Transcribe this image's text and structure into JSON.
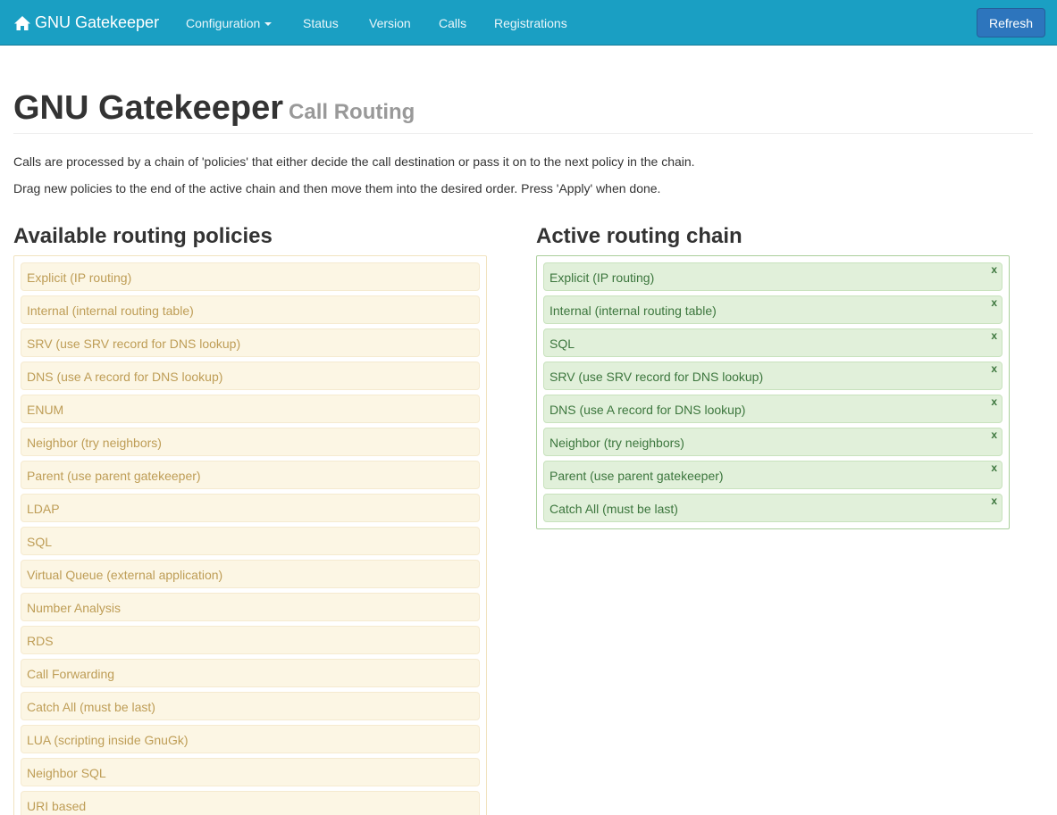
{
  "navbar": {
    "brand": "GNU Gatekeeper",
    "items": [
      "Configuration",
      "Status",
      "Version",
      "Calls",
      "Registrations"
    ],
    "refresh_label": "Refresh"
  },
  "header": {
    "title": "GNU Gatekeeper",
    "subtitle": "Call Routing"
  },
  "description": [
    "Calls are processed by a chain of 'policies' that either decide the call destination or pass it on to the next policy in the chain.",
    "Drag new policies to the end of the active chain and then move them into the desired order. Press 'Apply' when done."
  ],
  "available": {
    "title": "Available routing policies",
    "items": [
      "Explicit (IP routing)",
      "Internal (internal routing table)",
      "SRV (use SRV record for DNS lookup)",
      "DNS (use A record for DNS lookup)",
      "ENUM",
      "Neighbor (try neighbors)",
      "Parent (use parent gatekeeper)",
      "LDAP",
      "SQL",
      "Virtual Queue (external application)",
      "Number Analysis",
      "RDS",
      "Call Forwarding",
      "Catch All (must be last)",
      "LUA (scripting inside GnuGk)",
      "Neighbor SQL",
      "URI based"
    ]
  },
  "active": {
    "title": "Active routing chain",
    "remove_label": "x",
    "items": [
      "Explicit (IP routing)",
      "Internal (internal routing table)",
      "SQL",
      "SRV (use SRV record for DNS lookup)",
      "DNS (use A record for DNS lookup)",
      "Neighbor (try neighbors)",
      "Parent (use parent gatekeeper)",
      "Catch All (must be last)"
    ]
  },
  "colors": {
    "navbar": "#1a9fc3",
    "refresh_button": "#2d75bd",
    "available_item_bg": "#fcf6e4",
    "available_item_text": "#be9d56",
    "active_item_bg": "#e1f0da",
    "active_item_text": "#3c763d"
  },
  "icons": {
    "brand": "home-icon",
    "dropdown": "caret-down-icon"
  }
}
